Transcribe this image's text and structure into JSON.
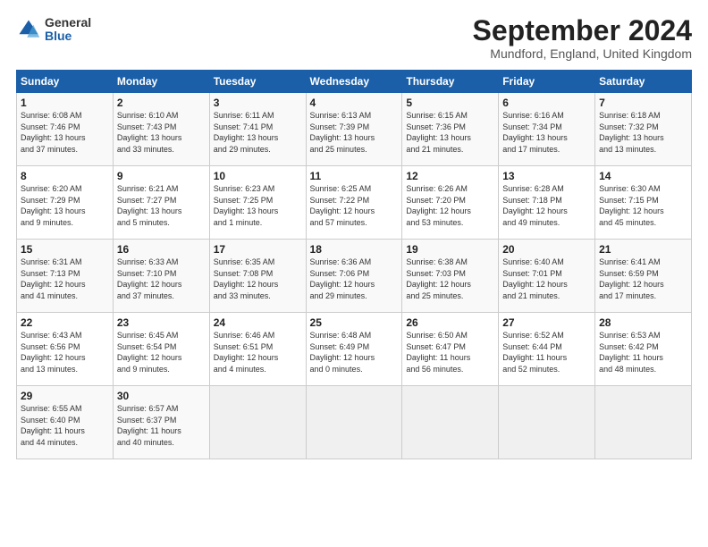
{
  "header": {
    "logo_line1": "General",
    "logo_line2": "Blue",
    "month_title": "September 2024",
    "location": "Mundford, England, United Kingdom"
  },
  "days_of_week": [
    "Sunday",
    "Monday",
    "Tuesday",
    "Wednesday",
    "Thursday",
    "Friday",
    "Saturday"
  ],
  "weeks": [
    [
      {
        "day": "1",
        "info": "Sunrise: 6:08 AM\nSunset: 7:46 PM\nDaylight: 13 hours\nand 37 minutes."
      },
      {
        "day": "2",
        "info": "Sunrise: 6:10 AM\nSunset: 7:43 PM\nDaylight: 13 hours\nand 33 minutes."
      },
      {
        "day": "3",
        "info": "Sunrise: 6:11 AM\nSunset: 7:41 PM\nDaylight: 13 hours\nand 29 minutes."
      },
      {
        "day": "4",
        "info": "Sunrise: 6:13 AM\nSunset: 7:39 PM\nDaylight: 13 hours\nand 25 minutes."
      },
      {
        "day": "5",
        "info": "Sunrise: 6:15 AM\nSunset: 7:36 PM\nDaylight: 13 hours\nand 21 minutes."
      },
      {
        "day": "6",
        "info": "Sunrise: 6:16 AM\nSunset: 7:34 PM\nDaylight: 13 hours\nand 17 minutes."
      },
      {
        "day": "7",
        "info": "Sunrise: 6:18 AM\nSunset: 7:32 PM\nDaylight: 13 hours\nand 13 minutes."
      }
    ],
    [
      {
        "day": "8",
        "info": "Sunrise: 6:20 AM\nSunset: 7:29 PM\nDaylight: 13 hours\nand 9 minutes."
      },
      {
        "day": "9",
        "info": "Sunrise: 6:21 AM\nSunset: 7:27 PM\nDaylight: 13 hours\nand 5 minutes."
      },
      {
        "day": "10",
        "info": "Sunrise: 6:23 AM\nSunset: 7:25 PM\nDaylight: 13 hours\nand 1 minute."
      },
      {
        "day": "11",
        "info": "Sunrise: 6:25 AM\nSunset: 7:22 PM\nDaylight: 12 hours\nand 57 minutes."
      },
      {
        "day": "12",
        "info": "Sunrise: 6:26 AM\nSunset: 7:20 PM\nDaylight: 12 hours\nand 53 minutes."
      },
      {
        "day": "13",
        "info": "Sunrise: 6:28 AM\nSunset: 7:18 PM\nDaylight: 12 hours\nand 49 minutes."
      },
      {
        "day": "14",
        "info": "Sunrise: 6:30 AM\nSunset: 7:15 PM\nDaylight: 12 hours\nand 45 minutes."
      }
    ],
    [
      {
        "day": "15",
        "info": "Sunrise: 6:31 AM\nSunset: 7:13 PM\nDaylight: 12 hours\nand 41 minutes."
      },
      {
        "day": "16",
        "info": "Sunrise: 6:33 AM\nSunset: 7:10 PM\nDaylight: 12 hours\nand 37 minutes."
      },
      {
        "day": "17",
        "info": "Sunrise: 6:35 AM\nSunset: 7:08 PM\nDaylight: 12 hours\nand 33 minutes."
      },
      {
        "day": "18",
        "info": "Sunrise: 6:36 AM\nSunset: 7:06 PM\nDaylight: 12 hours\nand 29 minutes."
      },
      {
        "day": "19",
        "info": "Sunrise: 6:38 AM\nSunset: 7:03 PM\nDaylight: 12 hours\nand 25 minutes."
      },
      {
        "day": "20",
        "info": "Sunrise: 6:40 AM\nSunset: 7:01 PM\nDaylight: 12 hours\nand 21 minutes."
      },
      {
        "day": "21",
        "info": "Sunrise: 6:41 AM\nSunset: 6:59 PM\nDaylight: 12 hours\nand 17 minutes."
      }
    ],
    [
      {
        "day": "22",
        "info": "Sunrise: 6:43 AM\nSunset: 6:56 PM\nDaylight: 12 hours\nand 13 minutes."
      },
      {
        "day": "23",
        "info": "Sunrise: 6:45 AM\nSunset: 6:54 PM\nDaylight: 12 hours\nand 9 minutes."
      },
      {
        "day": "24",
        "info": "Sunrise: 6:46 AM\nSunset: 6:51 PM\nDaylight: 12 hours\nand 4 minutes."
      },
      {
        "day": "25",
        "info": "Sunrise: 6:48 AM\nSunset: 6:49 PM\nDaylight: 12 hours\nand 0 minutes."
      },
      {
        "day": "26",
        "info": "Sunrise: 6:50 AM\nSunset: 6:47 PM\nDaylight: 11 hours\nand 56 minutes."
      },
      {
        "day": "27",
        "info": "Sunrise: 6:52 AM\nSunset: 6:44 PM\nDaylight: 11 hours\nand 52 minutes."
      },
      {
        "day": "28",
        "info": "Sunrise: 6:53 AM\nSunset: 6:42 PM\nDaylight: 11 hours\nand 48 minutes."
      }
    ],
    [
      {
        "day": "29",
        "info": "Sunrise: 6:55 AM\nSunset: 6:40 PM\nDaylight: 11 hours\nand 44 minutes."
      },
      {
        "day": "30",
        "info": "Sunrise: 6:57 AM\nSunset: 6:37 PM\nDaylight: 11 hours\nand 40 minutes."
      },
      {
        "day": "",
        "info": ""
      },
      {
        "day": "",
        "info": ""
      },
      {
        "day": "",
        "info": ""
      },
      {
        "day": "",
        "info": ""
      },
      {
        "day": "",
        "info": ""
      }
    ]
  ]
}
